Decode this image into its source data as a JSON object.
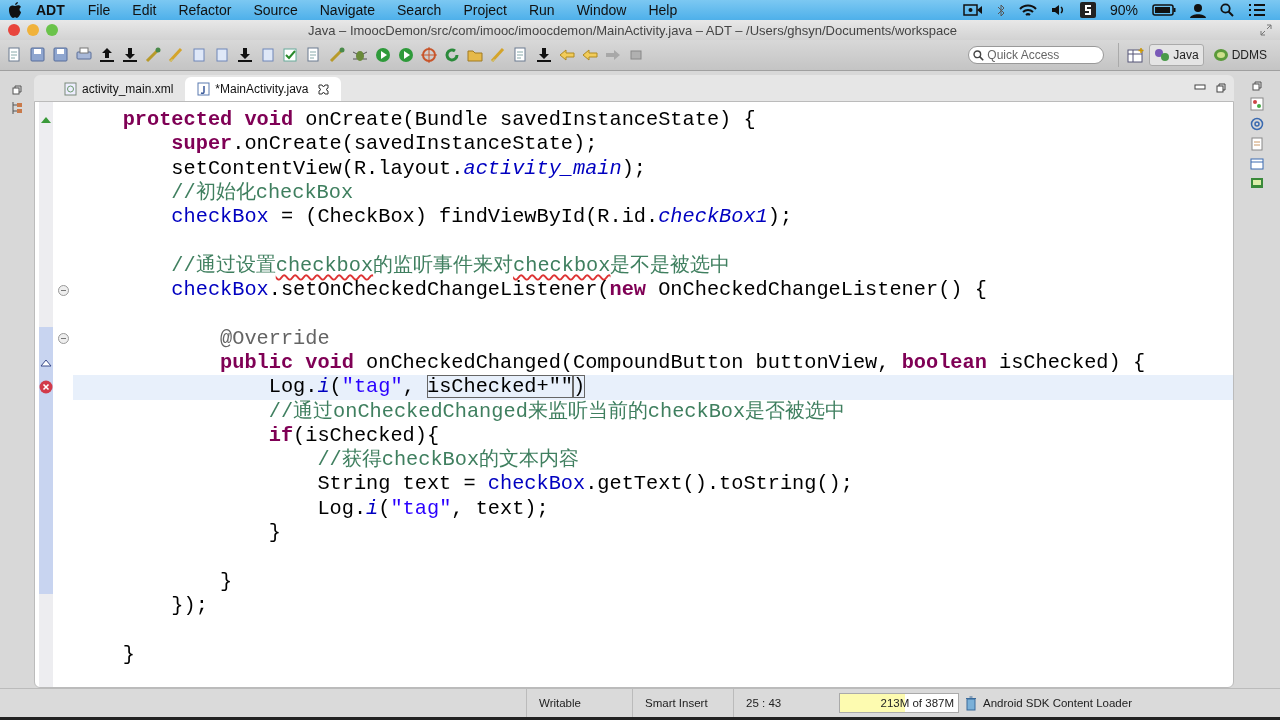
{
  "menu_bar": {
    "app": "ADT",
    "items": [
      "File",
      "Edit",
      "Refactor",
      "Source",
      "Navigate",
      "Search",
      "Project",
      "Run",
      "Window",
      "Help"
    ],
    "battery": "90%"
  },
  "window": {
    "title": "Java – ImoocDemon/src/com/imooc/imoocdemon/MainActivity.java – ADT – /Users/ghsyn/Documents/workspace"
  },
  "toolbar": {
    "quick_access": {
      "placeholder": "Quick Access"
    },
    "perspectives": [
      {
        "label": "Java",
        "selected": true
      },
      {
        "label": "DDMS",
        "selected": false
      }
    ]
  },
  "editor_tabs": [
    {
      "label": "activity_main.xml",
      "selected": false,
      "kind": "xml"
    },
    {
      "label": "*MainActivity.java",
      "selected": true,
      "kind": "java"
    }
  ],
  "editor": {
    "lines": [
      {
        "kind": "code",
        "marker": {
          "kind": "implements"
        },
        "changed": false,
        "current": false,
        "tokens": [
          {
            "kind": "kw",
            "t": "    protected void"
          },
          {
            "kind": "plain",
            "t": " onCreate(Bundle savedInstanceState) {"
          }
        ]
      },
      {
        "kind": "code",
        "changed": false,
        "current": false,
        "tokens": [
          {
            "kind": "kw",
            "t": "        super"
          },
          {
            "kind": "plain",
            "t": ".onCreate(savedInstanceState);"
          }
        ]
      },
      {
        "kind": "code",
        "changed": false,
        "current": false,
        "tokens": [
          {
            "kind": "plain",
            "t": "        setContentView(R.layout."
          },
          {
            "kind": "static",
            "t": "activity_main"
          },
          {
            "kind": "plain",
            "t": ");"
          }
        ]
      },
      {
        "kind": "code",
        "changed": false,
        "current": false,
        "tokens": [
          {
            "kind": "comment",
            "t": "        //初始化checkBox"
          }
        ]
      },
      {
        "kind": "code",
        "changed": false,
        "current": false,
        "tokens": [
          {
            "kind": "field",
            "t": "        checkBox"
          },
          {
            "kind": "plain",
            "t": " = (CheckBox) findViewById(R.id."
          },
          {
            "kind": "static",
            "t": "checkBox1"
          },
          {
            "kind": "plain",
            "t": ");"
          }
        ]
      },
      {
        "kind": "blank",
        "changed": false,
        "current": false
      },
      {
        "kind": "code",
        "changed": false,
        "current": false,
        "tokens": [
          {
            "kind": "comment",
            "t": "        //通过设置"
          },
          {
            "kind": "misspelled",
            "t": "checkbox"
          },
          {
            "kind": "comment",
            "t": "的监听事件来对"
          },
          {
            "kind": "misspelled",
            "t": "checkbox"
          },
          {
            "kind": "comment",
            "t": "是不是被选中"
          }
        ]
      },
      {
        "kind": "code",
        "marker": {
          "kind": "fold"
        },
        "changed": false,
        "current": false,
        "tokens": [
          {
            "kind": "field",
            "t": "        checkBox"
          },
          {
            "kind": "plain",
            "t": ".setOnCheckedChangeListener("
          },
          {
            "kind": "kw",
            "t": "new"
          },
          {
            "kind": "plain",
            "t": " OnCheckedChangeListener() {"
          }
        ]
      },
      {
        "kind": "blank",
        "changed": false,
        "current": false
      },
      {
        "kind": "code",
        "marker": {
          "kind": "fold"
        },
        "changed": true,
        "current": false,
        "tokens": [
          {
            "kind": "annotation",
            "t": "            @Override"
          }
        ]
      },
      {
        "kind": "code",
        "marker": {
          "kind": "overrides"
        },
        "changed": true,
        "current": false,
        "tokens": [
          {
            "kind": "kw",
            "t": "            public void"
          },
          {
            "kind": "plain",
            "t": " onCheckedChanged(CompoundButton buttonView, "
          },
          {
            "kind": "kw",
            "t": "boolean"
          },
          {
            "kind": "plain",
            "t": " isChecked) {"
          }
        ]
      },
      {
        "kind": "code",
        "marker": {
          "kind": "error"
        },
        "changed": true,
        "current": true,
        "tokens": [
          {
            "kind": "plain",
            "t": "                Log."
          },
          {
            "kind": "static",
            "t": "i"
          },
          {
            "kind": "plain",
            "t": "("
          },
          {
            "kind": "string",
            "t": "\"tag\""
          },
          {
            "kind": "plain",
            "t": ", "
          },
          {
            "kind": "linked",
            "t": "isChecked+\"\""
          },
          {
            "kind": "linked",
            "t": ")"
          }
        ]
      },
      {
        "kind": "code",
        "changed": true,
        "current": false,
        "tokens": [
          {
            "kind": "comment",
            "t": "                //通过onCheckedChanged来监听当前的checkBox是否被选中"
          }
        ]
      },
      {
        "kind": "code",
        "changed": true,
        "current": false,
        "tokens": [
          {
            "kind": "kw",
            "t": "                if"
          },
          {
            "kind": "plain",
            "t": "(isChecked){"
          }
        ]
      },
      {
        "kind": "code",
        "changed": true,
        "current": false,
        "tokens": [
          {
            "kind": "comment",
            "t": "                    //获得checkBox的文本内容"
          }
        ]
      },
      {
        "kind": "code",
        "changed": true,
        "current": false,
        "tokens": [
          {
            "kind": "plain",
            "t": "                    String text = "
          },
          {
            "kind": "field",
            "t": "checkBox"
          },
          {
            "kind": "plain",
            "t": ".getText().toString();"
          }
        ]
      },
      {
        "kind": "code",
        "changed": true,
        "current": false,
        "tokens": [
          {
            "kind": "plain",
            "t": "                    Log."
          },
          {
            "kind": "static",
            "t": "i"
          },
          {
            "kind": "plain",
            "t": "("
          },
          {
            "kind": "string",
            "t": "\"tag\""
          },
          {
            "kind": "plain",
            "t": ", text);"
          }
        ]
      },
      {
        "kind": "code",
        "changed": true,
        "current": false,
        "tokens": [
          {
            "kind": "plain",
            "t": "                }"
          }
        ]
      },
      {
        "kind": "blank",
        "changed": true,
        "current": false
      },
      {
        "kind": "code",
        "changed": true,
        "current": false,
        "tokens": [
          {
            "kind": "plain",
            "t": "            }"
          }
        ]
      },
      {
        "kind": "code",
        "changed": false,
        "current": false,
        "tokens": [
          {
            "kind": "plain",
            "t": "        });"
          }
        ]
      },
      {
        "kind": "blank",
        "changed": false,
        "current": false
      },
      {
        "kind": "code",
        "changed": false,
        "current": false,
        "tokens": [
          {
            "kind": "plain",
            "t": "    }"
          }
        ]
      }
    ]
  },
  "status_bar": {
    "mode": "Writable",
    "insert": "Smart Insert",
    "position": "25 : 43",
    "heap": {
      "text": "213M of 387M",
      "level": 0.55
    },
    "job": "Android SDK Content Loader"
  }
}
